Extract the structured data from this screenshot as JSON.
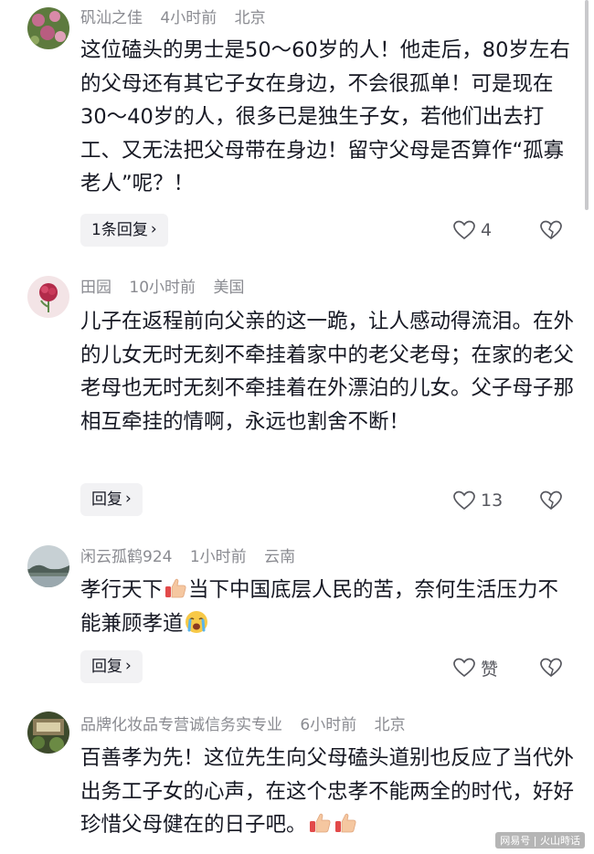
{
  "comments": [
    {
      "username": "矾汕之佳",
      "time": "4小时前",
      "location": "北京",
      "text": "这位磕头的男士是50～60岁的人！他走后，80岁左右的父母还有其它子女在身边，不会很孤单！可是现在30～40岁的人，很多已是独生子女，若他们出去打工、又无法把父母带在身边！留守父母是否算作“孤寡老人”呢？！",
      "reply_label": "1条回复",
      "like_count": "4",
      "avatar_icon": "flower-photo-avatar"
    },
    {
      "username": "田园",
      "time": "10小时前",
      "location": "美国",
      "text": "儿子在返程前向父亲的这一跪，让人感动得流泪。在外的儿女无时无刻不牵挂着家中的老父老母；在家的老父老母也无时无刻不牵挂着在外漂泊的儿女。父子母子那相互牵挂的情啊，永远也割舍不断！",
      "reply_label": "回复",
      "like_count": "13",
      "avatar_icon": "pink-flower-avatar"
    },
    {
      "username": "闲云孤鹤924",
      "time": "1小时前",
      "location": "云南",
      "text_part1": "孝行天下",
      "text_part2": "当下中国底层人民的苦，奈何生活压力不能兼顾孝道",
      "reply_label": "回复",
      "like_count": "赞",
      "avatar_icon": "landscape-avatar"
    },
    {
      "username": "品牌化妆品专营诚信务实专业",
      "time": "6小时前",
      "location": "北京",
      "text": "百善孝为先！这位先生向父母磕头道别也反应了当代外出务工子女的心声，在这个忠孝不能两全的时代，好好珍惜父母健在的日子吧。",
      "avatar_icon": "garden-avatar"
    }
  ],
  "icons": {
    "like": "heart-outline-icon",
    "dislike": "broken-heart-icon",
    "chevron": "chevron-right-icon",
    "thumbs_up_emoji": "thumbs-up-emoji",
    "crying_emoji": "crying-face-emoji"
  },
  "colors": {
    "text_primary": "#161823",
    "text_secondary": "#8a8b91",
    "button_bg": "#f2f2f4"
  },
  "watermark": "网易号 | 火山時话"
}
